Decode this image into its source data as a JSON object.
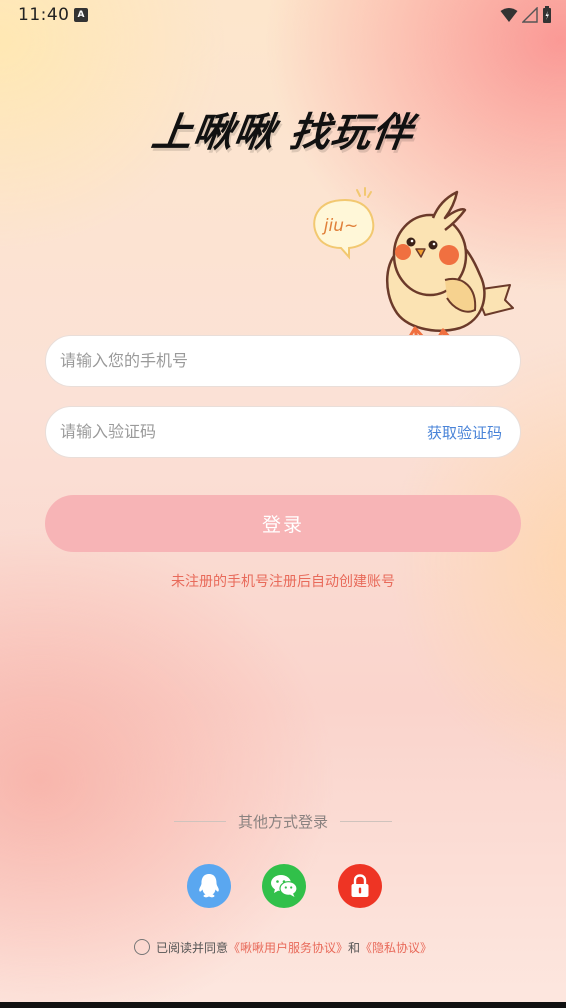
{
  "status_bar": {
    "time": "11:40",
    "notification_badge": "A"
  },
  "header": {
    "slogan": "上啾啾 找玩伴",
    "mascot_bubble": "jiu~"
  },
  "form": {
    "phone_placeholder": "请输入您的手机号",
    "code_placeholder": "请输入验证码",
    "get_code_label": "获取验证码",
    "login_label": "登录",
    "hint": "未注册的手机号注册后自动创建账号"
  },
  "other_login": {
    "title": "其他方式登录",
    "methods": [
      {
        "name": "qq",
        "icon": "qq-icon",
        "color": "#5aa7f0"
      },
      {
        "name": "wechat",
        "icon": "wechat-icon",
        "color": "#31c04a"
      },
      {
        "name": "password",
        "icon": "lock-icon",
        "color": "#ee3424"
      }
    ]
  },
  "agreement": {
    "prefix": "已阅读并同意",
    "terms": "《啾啾用户服务协议》",
    "and": "和",
    "privacy": "《隐私协议》",
    "link_color": "#e86a5a"
  },
  "colors": {
    "login_button": "#f7b4b6",
    "hint_text": "#e86a5a",
    "get_code_text": "#4a84d8"
  }
}
